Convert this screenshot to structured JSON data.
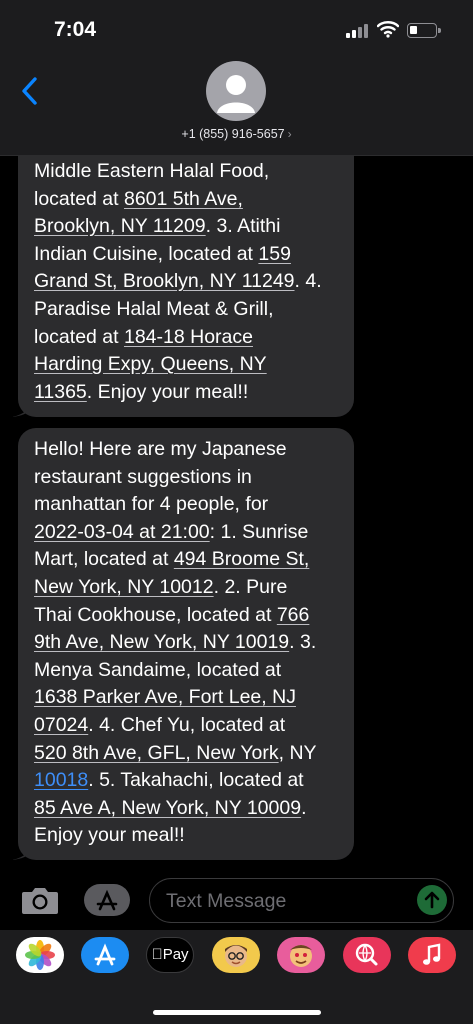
{
  "status_bar": {
    "time": "7:04"
  },
  "header": {
    "contact": "+1 (855) 916-5657",
    "contact_chevron": "›"
  },
  "messages": [
    {
      "lines": [
        [
          {
            "t": "Middle Eastern Halal Food,"
          }
        ],
        [
          {
            "t": "located at "
          },
          {
            "t": "8601 5th Ave,",
            "u": 1
          }
        ],
        [
          {
            "t": "Brooklyn, NY 11209",
            "u": 1
          },
          {
            "t": ". 3. Atithi"
          }
        ],
        [
          {
            "t": "Indian Cuisine, located at "
          },
          {
            "t": "159",
            "u": 1
          }
        ],
        [
          {
            "t": "Grand St, Brooklyn, NY 11249",
            "u": 1
          },
          {
            "t": ". 4."
          }
        ],
        [
          {
            "t": "Paradise Halal Meat & Grill,"
          }
        ],
        [
          {
            "t": "located at "
          },
          {
            "t": "184-18 Horace",
            "u": 1
          }
        ],
        [
          {
            "t": "Harding Expy, Queens, NY",
            "u": 1
          }
        ],
        [
          {
            "t": "11365",
            "u": 1
          },
          {
            "t": ". Enjoy your meal!!"
          }
        ]
      ]
    },
    {
      "lines": [
        [
          {
            "t": "Hello! Here are my Japanese"
          }
        ],
        [
          {
            "t": "restaurant suggestions in"
          }
        ],
        [
          {
            "t": "manhattan for 4 people, for"
          }
        ],
        [
          {
            "t": "2022-03-04 at 21:00",
            "u": 1
          },
          {
            "t": ": 1. Sunrise"
          }
        ],
        [
          {
            "t": "Mart, located at "
          },
          {
            "t": "494 Broome St,",
            "u": 1
          }
        ],
        [
          {
            "t": "New York, NY 10012",
            "u": 1
          },
          {
            "t": ". 2. Pure"
          }
        ],
        [
          {
            "t": "Thai Cookhouse, located at "
          },
          {
            "t": "766",
            "u": 1
          }
        ],
        [
          {
            "t": "9th Ave, New York, NY 10019",
            "u": 1
          },
          {
            "t": ". 3."
          }
        ],
        [
          {
            "t": "Menya Sandaime, located at"
          }
        ],
        [
          {
            "t": "1638 Parker Ave, Fort Lee, NJ",
            "u": 1
          }
        ],
        [
          {
            "t": "07024",
            "u": 1
          },
          {
            "t": ". 4. Chef Yu, located at"
          }
        ],
        [
          {
            "t": "520 8th Ave, GFL, New York",
            "u": 1
          },
          {
            "t": ", NY"
          }
        ],
        [
          {
            "t": "10018",
            "link": 1
          },
          {
            "t": ". 5. Takahachi, located at"
          }
        ],
        [
          {
            "t": "85 Ave A, New York, NY 10009",
            "u": 1
          },
          {
            "t": "."
          }
        ],
        [
          {
            "t": "Enjoy your meal!!"
          }
        ]
      ]
    }
  ],
  "composer": {
    "placeholder": "Text Message"
  },
  "app_drawer": {
    "apple_pay_label": "Pay",
    "apps": [
      "photos-icon",
      "app-store-icon",
      "apple-pay-icon",
      "memoji-icon",
      "animoji-icon",
      "web-search-icon",
      "music-icon"
    ]
  },
  "colors": {
    "bubble": "#2c2c2e",
    "link": "#3e8ef7",
    "send": "#1e6b37",
    "back": "#0a84ff"
  }
}
